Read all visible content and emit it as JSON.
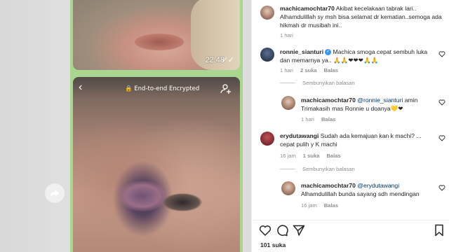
{
  "media": {
    "message1_time": "22.48",
    "message1_ticks": "✓✓",
    "message2_header": "End-to-end Encrypted"
  },
  "comments": {
    "post_caption": {
      "username": "machicamochtar70",
      "text": "Akibat kecelakaan tabrak lari.. Alhamdulillah sy msh bisa selamat dr kematian..semoga ada hikmah dr musibah ini..",
      "time": "1 hari"
    },
    "c1": {
      "username": "ronnie_sianturi",
      "text": "Machica smoga cepat sembuh luka dan memarnya ya.. 🙏🙏❤❤❤🙏🙏",
      "time": "1 hari",
      "likes": "2 suka",
      "reply": "Balas",
      "hide": "Sembunyikan balasan"
    },
    "c1_reply": {
      "username": "machicamochtar70",
      "mention": "@ronnie_sianturi",
      "text": "amin Trimakasih mas Ronnie u doanya💛❤",
      "time": "1 hari",
      "reply": "Balas"
    },
    "c2": {
      "username": "erydutawangi",
      "text": "Sudah ada kemajuan kan k machi? ... cepat pulih y K machi",
      "time": "16 jam",
      "likes": "1 suka",
      "reply": "Balas",
      "hide": "Sembunyikan balasan"
    },
    "c2_reply": {
      "username": "machicamochtar70",
      "mention": "@erydutawangi",
      "text": "Alhamdulillah bunda sayang sdh mendingan",
      "time": "16 jam",
      "reply": "Balas"
    }
  },
  "footer": {
    "likes": "101 suka"
  },
  "colors": {
    "whatsapp_green": "#a9d78f",
    "mention_blue": "#00376b",
    "meta_gray": "#8e8e8e"
  }
}
